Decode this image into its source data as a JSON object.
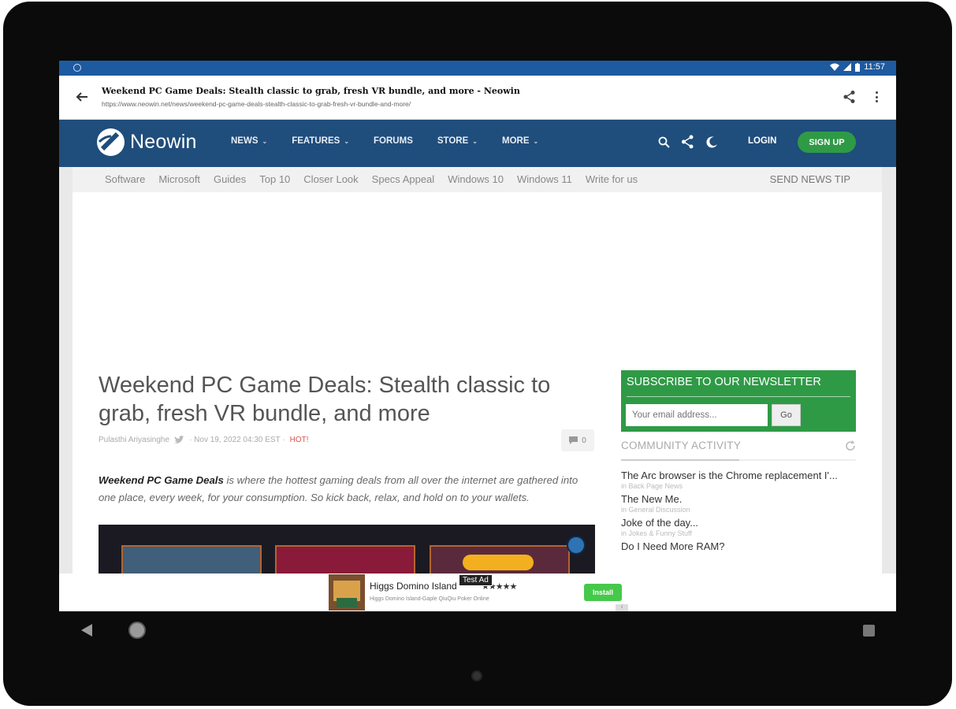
{
  "status_bar": {
    "time": "11:57"
  },
  "browser_toolbar": {
    "title": "Weekend PC Game Deals: Stealth classic to grab, fresh VR bundle, and more - Neowin",
    "url": "https://www.neowin.net/news/weekend-pc-game-deals-stealth-classic-to-grab-fresh-vr-bundle-and-more/",
    "back_icon": "arrow-left-icon",
    "share_icon": "share-icon",
    "menu_icon": "more-vert-icon"
  },
  "site_header": {
    "logo_text": "Neowin",
    "nav": [
      {
        "label": "NEWS",
        "dropdown": true
      },
      {
        "label": "FEATURES",
        "dropdown": true
      },
      {
        "label": "FORUMS",
        "dropdown": false
      },
      {
        "label": "STORE",
        "dropdown": true
      },
      {
        "label": "MORE",
        "dropdown": true
      }
    ],
    "login": "LOGIN",
    "signup": "SIGN UP",
    "colors": {
      "header_bg": "#1f4d7c",
      "signup_bg": "#2f9a46"
    }
  },
  "category_bar": {
    "items": [
      "Software",
      "Microsoft",
      "Guides",
      "Top 10",
      "Closer Look",
      "Specs Appeal",
      "Windows 10",
      "Windows 11",
      "Write for us"
    ],
    "news_tip": "SEND NEWS TIP"
  },
  "article": {
    "title": "Weekend PC Game Deals: Stealth classic to grab, fresh VR bundle, and more",
    "author": "Pulasthi Ariyasinghe",
    "date": "· Nov 19, 2022 04:30 EST ·",
    "hot": "HOT!",
    "comment_count": "0",
    "intro_bold": "Weekend PC Game Deals",
    "intro_rest": " is where the hottest gaming deals from all over the internet are gathered into one place, every week, for your consumption. So kick back, relax, and hold on to your wallets."
  },
  "newsletter": {
    "title": "SUBSCRIBE TO OUR NEWSLETTER",
    "placeholder": "Your email address...",
    "go": "Go"
  },
  "community_activity": {
    "title": "COMMUNITY ACTIVITY",
    "items": [
      {
        "title": "The Arc browser is the Chrome replacement I'...",
        "category": "in Back Page News"
      },
      {
        "title": "The New Me.",
        "category": "in General Discussion"
      },
      {
        "title": "Joke of the day...",
        "category": "in Jokes & Funny Stuff"
      },
      {
        "title": "Do I Need More RAM?",
        "category": ""
      }
    ]
  },
  "ad_banner": {
    "label": "Test Ad",
    "title": "Higgs Domino Island",
    "subtitle": "Higgs Domino Island-Gaple QiuQiu Poker Online",
    "stars": "★★★★★",
    "install": "Install"
  }
}
